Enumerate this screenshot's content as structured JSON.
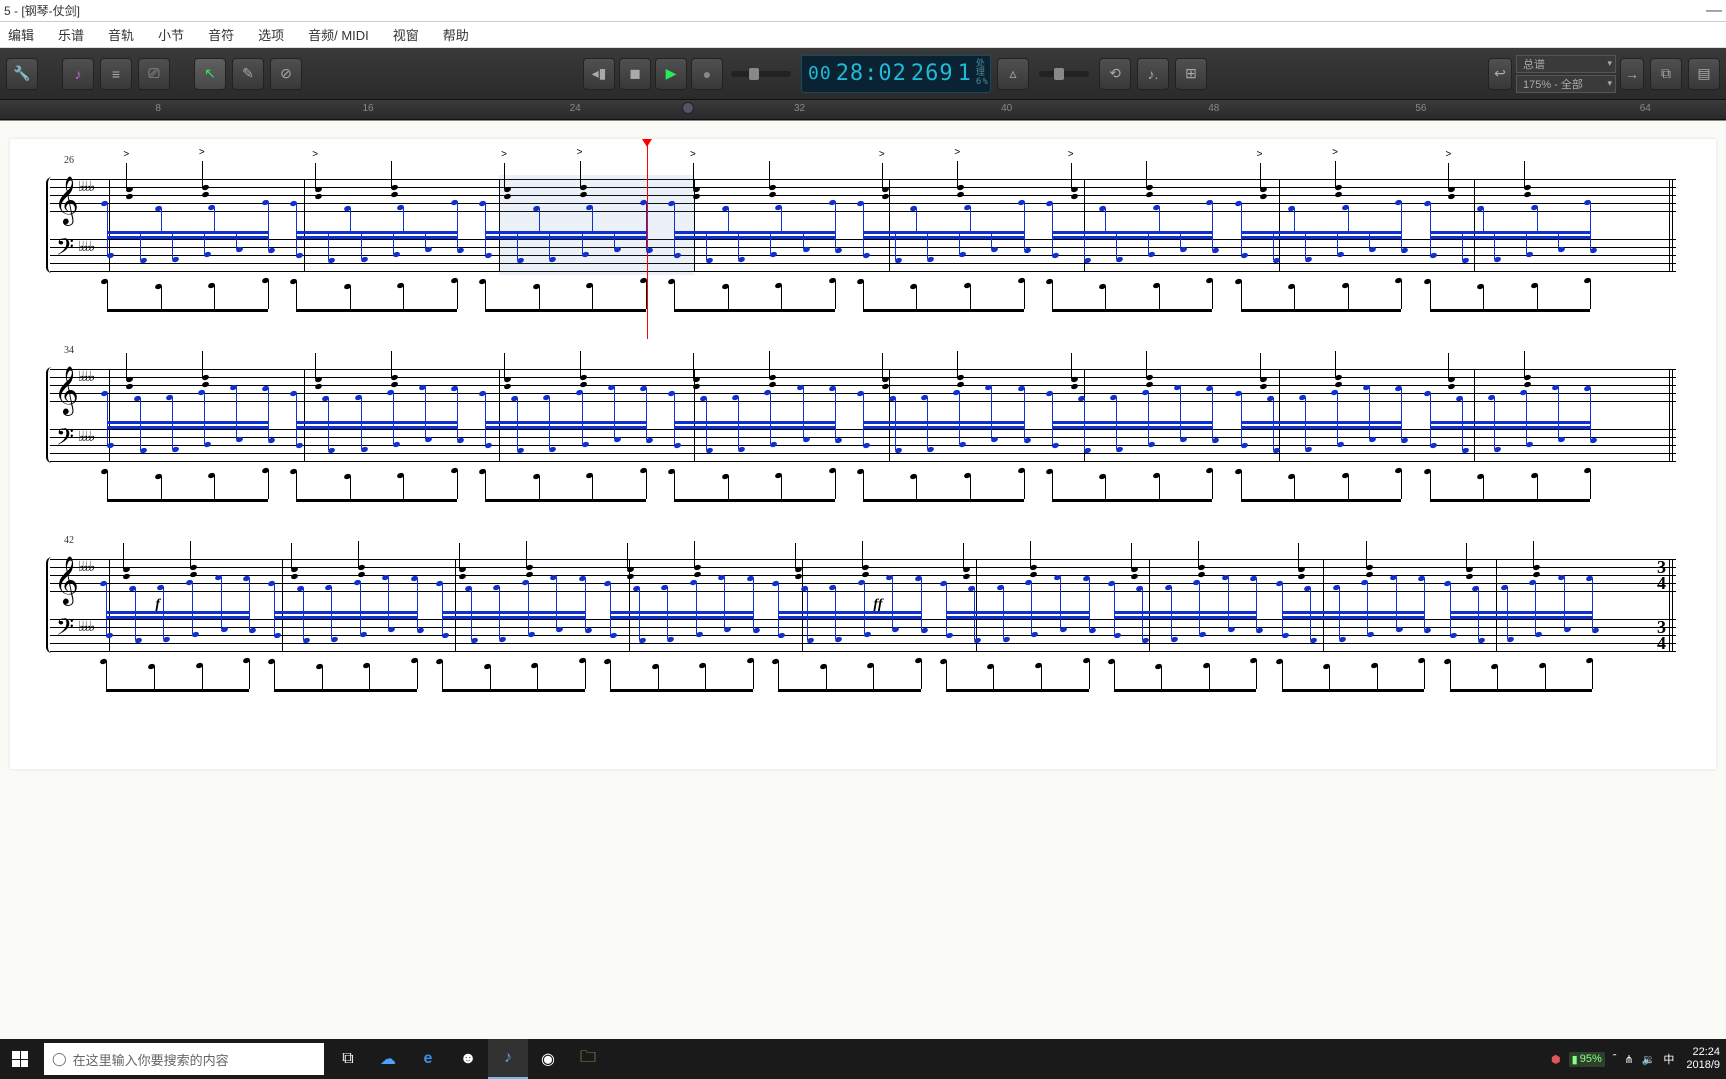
{
  "title": "5 - [钢琴-仗剑]",
  "menu": [
    "编辑",
    "乐谱",
    "音轨",
    "小节",
    "音符",
    "选项",
    "音频/ MIDI",
    "视窗",
    "帮助"
  ],
  "counter": {
    "bars": "00",
    "beats": "28:02",
    "ticks": "269",
    "extra": "1",
    "cpu_label": "处理",
    "cpu_pct": "6%"
  },
  "ruler_ticks": [
    8,
    16,
    24,
    32,
    40,
    48,
    56,
    64
  ],
  "dropdowns": {
    "score": "总谱",
    "zoom": "175% - 全部"
  },
  "score": {
    "systems": [
      {
        "measure_start": 26,
        "bars": 8,
        "has_playhead": true,
        "playhead_x": 0.345,
        "selection": [
          0.25,
          0.375
        ],
        "dyn": []
      },
      {
        "measure_start": 34,
        "bars": 8,
        "has_playhead": false,
        "dyn": []
      },
      {
        "measure_start": 42,
        "bars": 9,
        "has_playhead": false,
        "dyn": [
          {
            "t": "f",
            "x": 0.03
          },
          {
            "t": "ff",
            "x": 0.49
          }
        ],
        "timesig_end": "3/4"
      }
    ],
    "key_flats": 4
  },
  "taskbar": {
    "search_placeholder": "在这里输入你要搜索的内容",
    "battery": "95%",
    "ime": "中",
    "time": "22:24",
    "date": "2018/9"
  }
}
